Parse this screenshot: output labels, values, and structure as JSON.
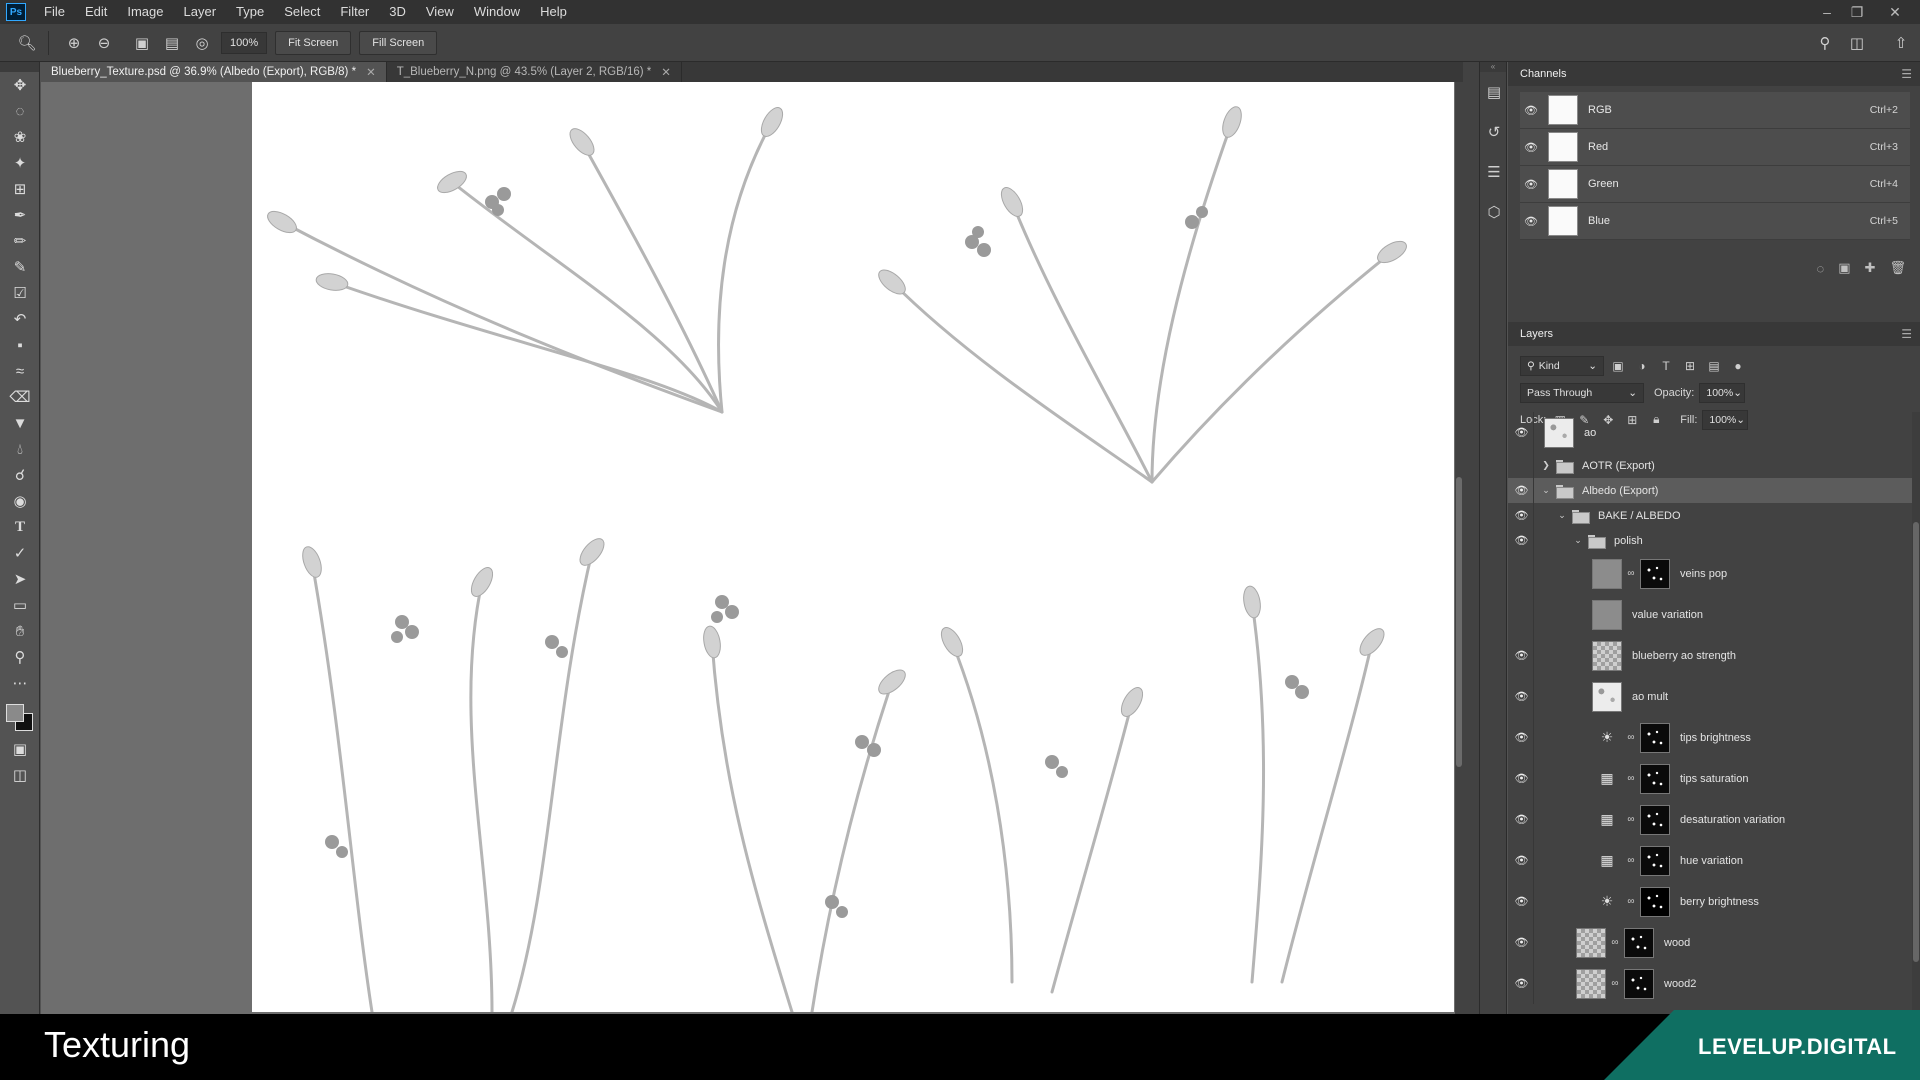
{
  "menu": [
    "File",
    "Edit",
    "Image",
    "Layer",
    "Type",
    "Select",
    "Filter",
    "3D",
    "View",
    "Window",
    "Help"
  ],
  "options": {
    "zoom_value": "100%",
    "fit_screen": "Fit Screen",
    "fill_screen": "Fill Screen"
  },
  "tabs": [
    {
      "label": "Blueberry_Texture.psd @ 36.9% (Albedo (Export), RGB/8) *",
      "active": true
    },
    {
      "label": "T_Blueberry_N.png @ 43.5% (Layer 2, RGB/16) *",
      "active": false
    }
  ],
  "channels": {
    "title": "Channels",
    "rows": [
      {
        "name": "RGB",
        "shortcut": "Ctrl+2"
      },
      {
        "name": "Red",
        "shortcut": "Ctrl+3"
      },
      {
        "name": "Green",
        "shortcut": "Ctrl+4"
      },
      {
        "name": "Blue",
        "shortcut": "Ctrl+5"
      }
    ]
  },
  "layers": {
    "title": "Layers",
    "filter_kind": "Kind",
    "blend_mode": "Pass Through",
    "opacity_label": "Opacity:",
    "opacity_value": "100%",
    "lock_label": "Lock:",
    "fill_label": "Fill:",
    "fill_value": "100%",
    "items": [
      {
        "name": "ao"
      },
      {
        "name": "AOTR (Export)"
      },
      {
        "name": "Albedo (Export)"
      },
      {
        "name": "BAKE / ALBEDO"
      },
      {
        "name": "polish"
      },
      {
        "name": "veins pop"
      },
      {
        "name": "value variation"
      },
      {
        "name": "blueberry ao strength"
      },
      {
        "name": "ao mult"
      },
      {
        "name": "tips brightness"
      },
      {
        "name": "tips saturation"
      },
      {
        "name": "desaturation variation"
      },
      {
        "name": "hue variation"
      },
      {
        "name": "berry brightness"
      },
      {
        "name": "wood"
      },
      {
        "name": "wood2"
      }
    ]
  },
  "overlay": {
    "title": "Texturing",
    "brand": "LEVELUP.DIGITAL",
    "brand_color": "#0f6f62"
  }
}
